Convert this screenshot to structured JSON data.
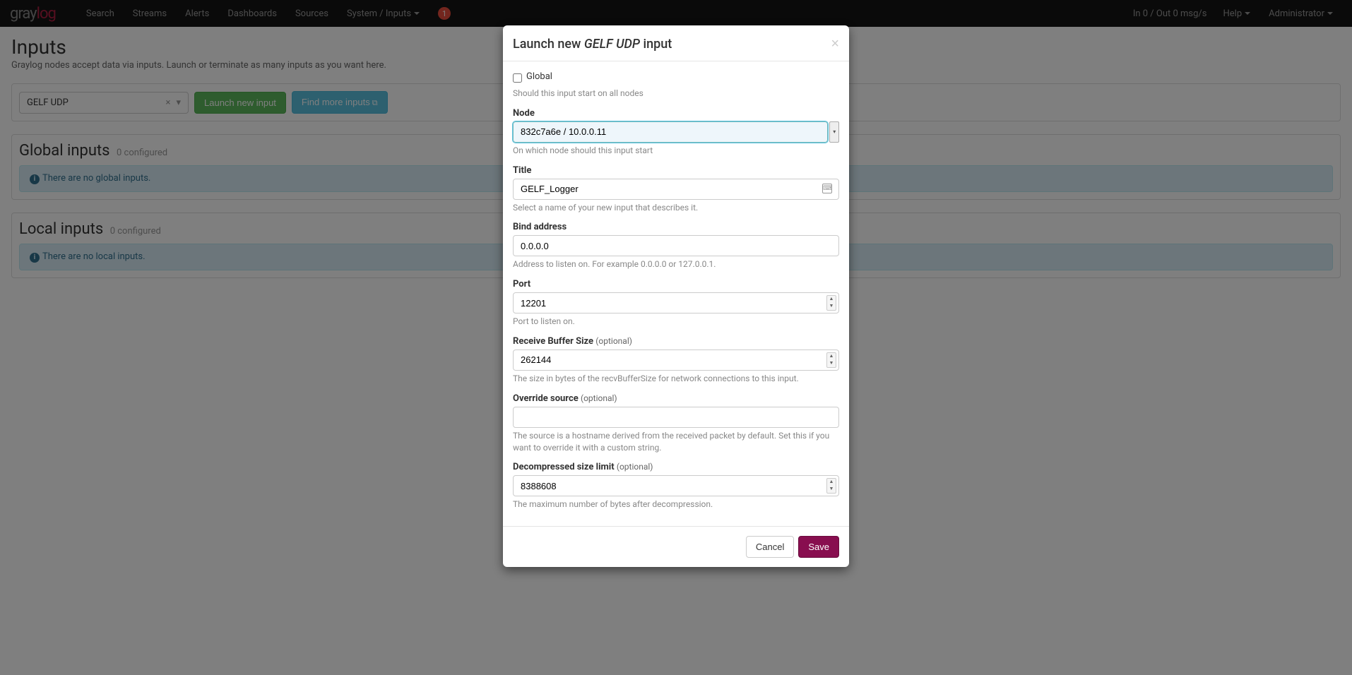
{
  "nav": {
    "logo_gray": "gray",
    "logo_log": "log",
    "items": [
      "Search",
      "Streams",
      "Alerts",
      "Dashboards",
      "Sources",
      "System / Inputs"
    ],
    "notif_count": "1",
    "throughput": "In 0 / Out 0 msg/s",
    "help": "Help",
    "admin": "Administrator"
  },
  "page": {
    "title": "Inputs",
    "desc": "Graylog nodes accept data via inputs. Launch or terminate as many inputs as you want here.",
    "selected_input": "GELF UDP",
    "launch_btn": "Launch new input",
    "find_btn": "Find more inputs"
  },
  "sections": {
    "global_title": "Global inputs",
    "global_count": "0 configured",
    "global_empty": "There are no global inputs.",
    "local_title": "Local inputs",
    "local_count": "0 configured",
    "local_empty": "There are no local inputs."
  },
  "modal": {
    "title_prefix": "Launch new ",
    "title_em": "GELF UDP",
    "title_suffix": " input",
    "global_label": "Global",
    "global_help": "Should this input start on all nodes",
    "node_label": "Node",
    "node_value": "832c7a6e / 10.0.0.11",
    "node_help": "On which node should this input start",
    "title_field_label": "Title",
    "title_field_value": "GELF_Logger",
    "title_field_help": "Select a name of your new input that describes it.",
    "bind_label": "Bind address",
    "bind_value": "0.0.0.0",
    "bind_help": "Address to listen on. For example 0.0.0.0 or 127.0.0.1.",
    "port_label": "Port",
    "port_value": "12201",
    "port_help": "Port to listen on.",
    "buffer_label": "Receive Buffer Size",
    "buffer_value": "262144",
    "buffer_help": "The size in bytes of the recvBufferSize for network connections to this input.",
    "override_label": "Override source",
    "override_value": "",
    "override_help": "The source is a hostname derived from the received packet by default. Set this if you want to override it with a custom string.",
    "decomp_label": "Decompressed size limit",
    "decomp_value": "8388608",
    "decomp_help": "The maximum number of bytes after decompression.",
    "optional": "(optional)",
    "cancel": "Cancel",
    "save": "Save"
  }
}
